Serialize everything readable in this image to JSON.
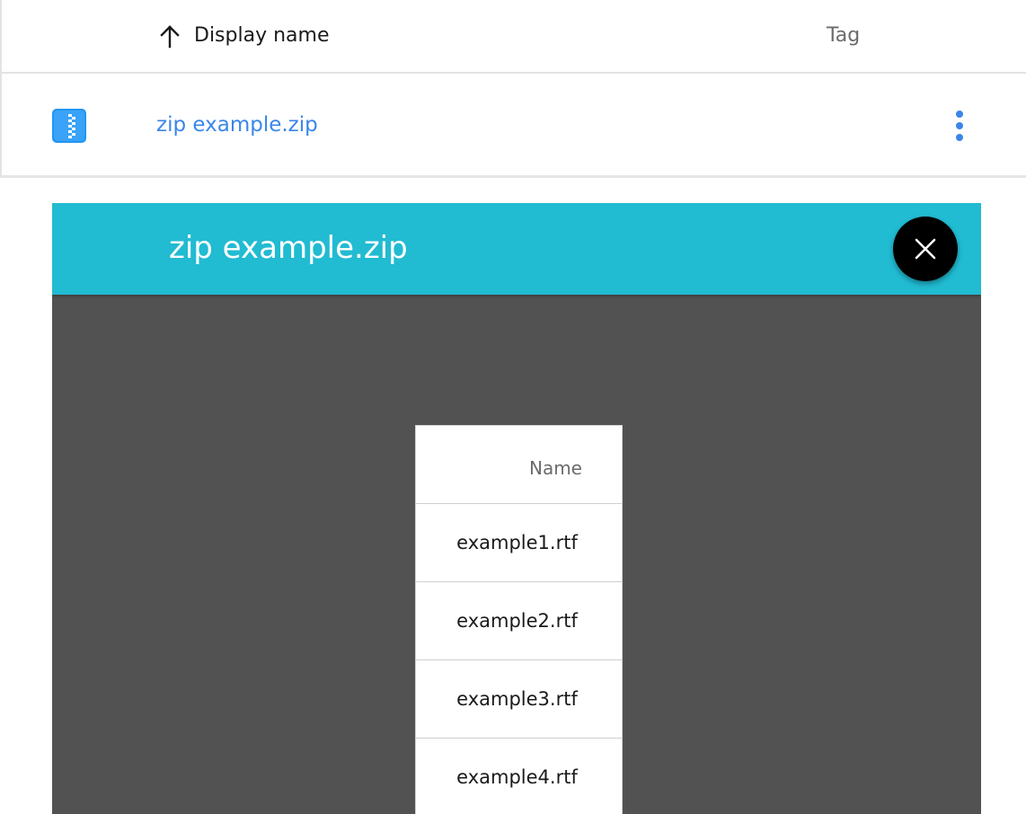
{
  "file_table": {
    "columns": {
      "display_name": "Display name",
      "tag": "Tag"
    },
    "sort_direction": "ascending",
    "rows": [
      {
        "icon": "zip-file-icon",
        "name": "zip example.zip"
      }
    ]
  },
  "viewer": {
    "title": "zip example.zip",
    "header_color": "#21bbd2",
    "contents": {
      "column_header": "Name",
      "files": [
        "example1.rtf",
        "example2.rtf",
        "example3.rtf",
        "example4.rtf"
      ]
    }
  },
  "colors": {
    "link": "#3a86e8",
    "zip_icon": "#2196f3",
    "viewer_background": "#525252",
    "close_button": "#000000"
  }
}
